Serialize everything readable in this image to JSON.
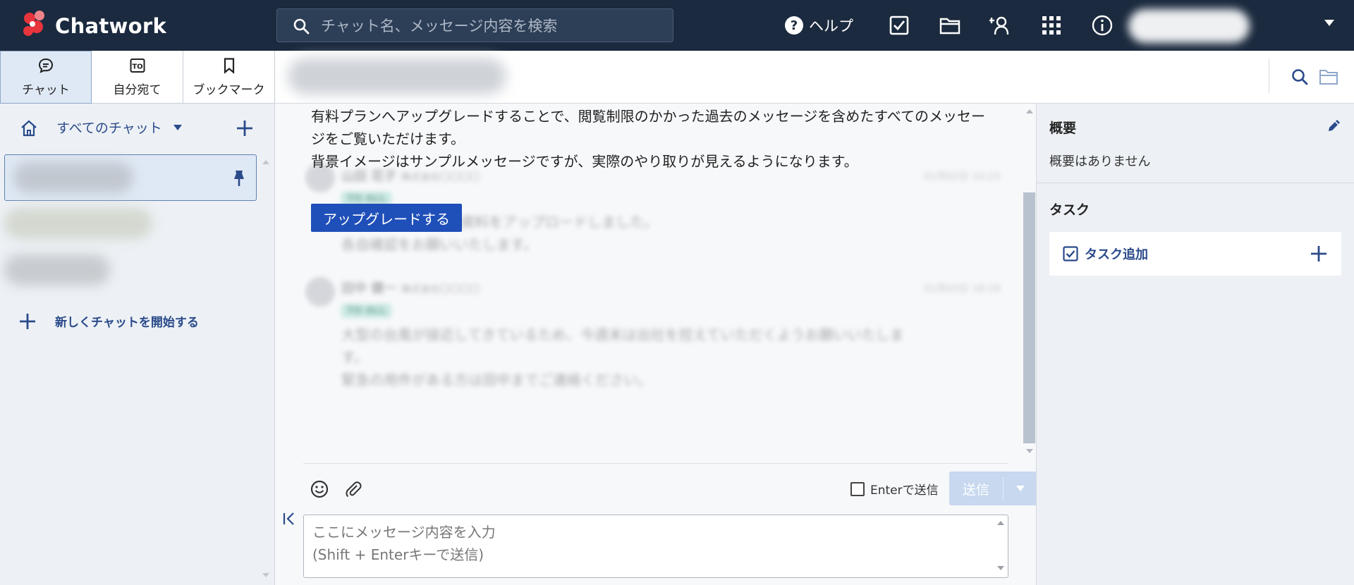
{
  "header": {
    "logo_text": "Chatwork",
    "search_placeholder": "チャット名、メッセージ内容を検索",
    "help_label": "ヘルプ",
    "help_glyph": "?"
  },
  "tabs": [
    {
      "label": "チャット",
      "active": true
    },
    {
      "label": "自分宛て",
      "active": false
    },
    {
      "label": "ブックマーク",
      "active": false
    }
  ],
  "sidebar": {
    "all_chats_label": "すべてのチャット",
    "new_chat_label": "新しくチャットを開始する"
  },
  "upgrade": {
    "text": "有料プランへアップグレードすることで、閲覧制限のかかった過去のメッセージを含めたすべてのメッセージをご覧いただけます。\n背景イメージはサンプルメッセージですが、実際のやり取りが見えるようになります。",
    "button_label": "アップグレードする"
  },
  "sample_messages": [
    {
      "name": "山田 花子",
      "company": "株式会社〇〇〇〇",
      "date": "01月02日 10:23",
      "to_label": "TO ALL",
      "text": "○○○○についての資料をアップロードしました。\n各自確認をお願いいたします。"
    },
    {
      "name": "田中 健一",
      "company": "株式会社〇〇〇〇",
      "date": "01月03日 18:19",
      "to_label": "TO ALL",
      "text": "大型の台風が接近してきているため、今週末は出社を控えていただくようお願いいたします。\n緊急の用件がある方は田中までご連絡ください。"
    }
  ],
  "composer": {
    "enter_send_label": "Enterで送信",
    "send_label": "送信",
    "placeholder": "ここにメッセージ内容を入力\n(Shift + Enterキーで送信)"
  },
  "right_panel": {
    "overview_title": "概要",
    "overview_empty": "概要はありません",
    "task_title": "タスク",
    "task_add_label": "タスク追加"
  },
  "colors": {
    "header_bg": "#1b2a3e",
    "accent_blue": "#1f4fb8",
    "link_blue": "#2a4a8a",
    "logo_red": "#e8343c"
  }
}
